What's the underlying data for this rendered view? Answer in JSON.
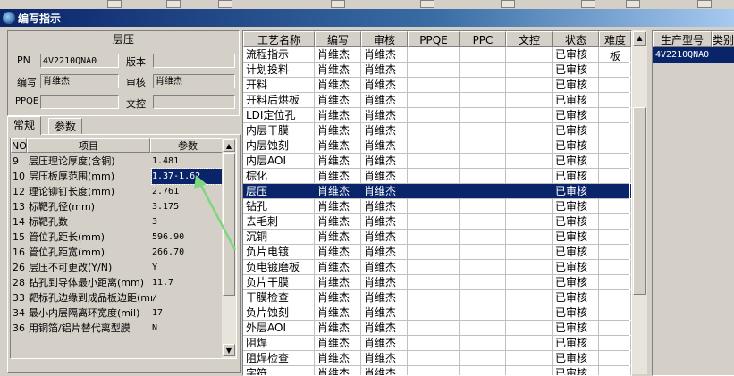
{
  "window": {
    "title": "编写指示"
  },
  "form": {
    "title": "层压",
    "pn_label": "PN",
    "pn_value": "4V2210QNA0",
    "version_label": "版本",
    "version_value": "",
    "author_label": "编写",
    "author_value": "肖维杰",
    "reviewer_label": "审核",
    "reviewer_value": "肖维杰",
    "ppqe_label": "PPQE",
    "ppqe_value": "",
    "doc_control_label": "文控",
    "doc_control_value": ""
  },
  "tabs": [
    {
      "label": "常规"
    },
    {
      "label": "参数"
    }
  ],
  "param_grid": {
    "headers": {
      "no": "NO",
      "item": "项目",
      "param": "参数"
    },
    "rows": [
      {
        "no": "9",
        "item": "层压理论厚度(含铜)",
        "param": "1.481"
      },
      {
        "no": "10",
        "item": "层压板厚范围(mm)",
        "param": "1.37-1.62"
      },
      {
        "no": "12",
        "item": "理论铆钉长度(mm)",
        "param": "2.761"
      },
      {
        "no": "13",
        "item": "标靶孔径(mm)",
        "param": "3.175"
      },
      {
        "no": "14",
        "item": "标靶孔数",
        "param": "3"
      },
      {
        "no": "15",
        "item": "管位孔距长(mm)",
        "param": "596.90"
      },
      {
        "no": "16",
        "item": "管位孔距宽(mm)",
        "param": "266.70"
      },
      {
        "no": "26",
        "item": "层压不可更改(Y/N)",
        "param": "Y"
      },
      {
        "no": "28",
        "item": "钻孔到导体最小距离(mm)",
        "param": "11.7"
      },
      {
        "no": "33",
        "item": "靶标孔边缘到成品板边距(mm)",
        "param": "/"
      },
      {
        "no": "34",
        "item": "最小内层隔离环宽度(mil)",
        "param": "17"
      },
      {
        "no": "36",
        "item": "用铜箔/铝片替代离型膜",
        "param": "N"
      }
    ],
    "selected_row": "10"
  },
  "process_table": {
    "headers": [
      "工艺名称",
      "编写",
      "审核",
      "PPQE",
      "PPC",
      "文控",
      "状态",
      "难度板"
    ],
    "rows": [
      {
        "name": "流程指示",
        "author": "肖维杰",
        "reviewer": "肖维杰",
        "status": "已审核"
      },
      {
        "name": "计划投料",
        "author": "肖维杰",
        "reviewer": "肖维杰",
        "status": "已审核"
      },
      {
        "name": "开料",
        "author": "肖维杰",
        "reviewer": "肖维杰",
        "status": "已审核"
      },
      {
        "name": "开料后烘板",
        "author": "肖维杰",
        "reviewer": "肖维杰",
        "status": "已审核"
      },
      {
        "name": "LDI定位孔",
        "author": "肖维杰",
        "reviewer": "肖维杰",
        "status": "已审核"
      },
      {
        "name": "内层干膜",
        "author": "肖维杰",
        "reviewer": "肖维杰",
        "status": "已审核"
      },
      {
        "name": "内层蚀刻",
        "author": "肖维杰",
        "reviewer": "肖维杰",
        "status": "已审核"
      },
      {
        "name": "内层AOI",
        "author": "肖维杰",
        "reviewer": "肖维杰",
        "status": "已审核"
      },
      {
        "name": "棕化",
        "author": "肖维杰",
        "reviewer": "肖维杰",
        "status": "已审核"
      },
      {
        "name": "层压",
        "author": "肖维杰",
        "reviewer": "肖维杰",
        "status": "已审核"
      },
      {
        "name": "钻孔",
        "author": "肖维杰",
        "reviewer": "肖维杰",
        "status": "已审核"
      },
      {
        "name": "去毛刺",
        "author": "肖维杰",
        "reviewer": "肖维杰",
        "status": "已审核"
      },
      {
        "name": "沉铜",
        "author": "肖维杰",
        "reviewer": "肖维杰",
        "status": "已审核"
      },
      {
        "name": "负片电镀",
        "author": "肖维杰",
        "reviewer": "肖维杰",
        "status": "已审核"
      },
      {
        "name": "负电镀磨板",
        "author": "肖维杰",
        "reviewer": "肖维杰",
        "status": "已审核"
      },
      {
        "name": "负片干膜",
        "author": "肖维杰",
        "reviewer": "肖维杰",
        "status": "已审核"
      },
      {
        "name": "干膜检查",
        "author": "肖维杰",
        "reviewer": "肖维杰",
        "status": "已审核"
      },
      {
        "name": "负片蚀刻",
        "author": "肖维杰",
        "reviewer": "肖维杰",
        "status": "已审核"
      },
      {
        "name": "外层AOI",
        "author": "肖维杰",
        "reviewer": "肖维杰",
        "status": "已审核"
      },
      {
        "name": "阻焊",
        "author": "肖维杰",
        "reviewer": "肖维杰",
        "status": "已审核"
      },
      {
        "name": "阻焊检查",
        "author": "肖维杰",
        "reviewer": "肖维杰",
        "status": "已审核"
      },
      {
        "name": "字符",
        "author": "肖维杰",
        "reviewer": "肖维杰",
        "status": "已审核"
      }
    ],
    "selected_row": "层压"
  },
  "model_table": {
    "headers": [
      "生产型号",
      "类别"
    ],
    "rows": [
      {
        "model": "4V2210QNA0"
      }
    ]
  },
  "colors": {
    "selection": "#0a246a",
    "face": "#d4d0c8",
    "annotation_arrow": "#7ed67e"
  }
}
